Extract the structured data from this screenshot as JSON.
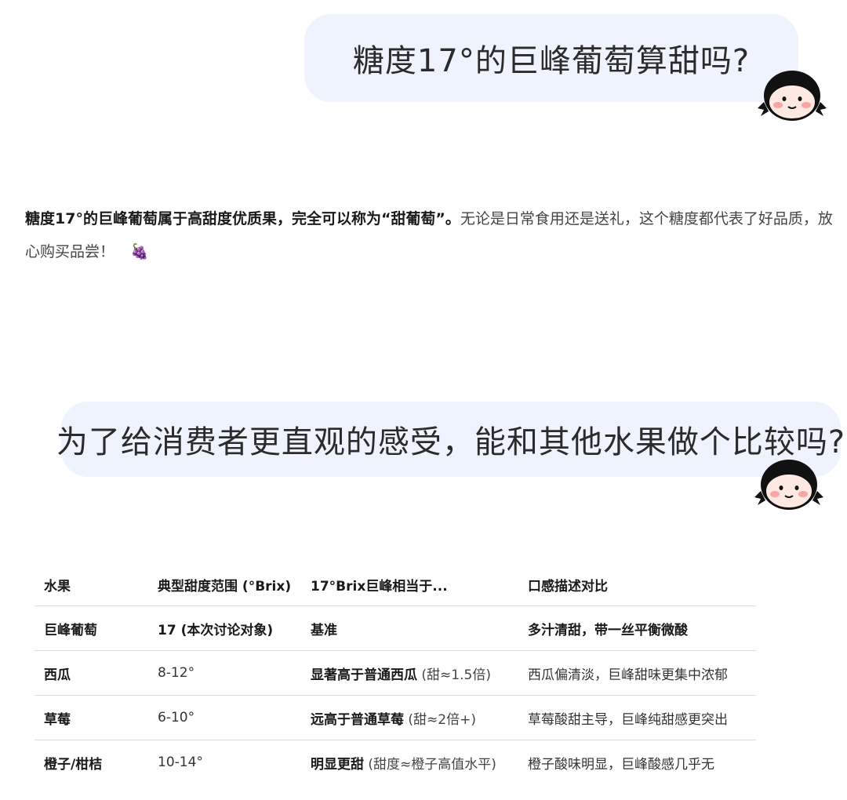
{
  "chat": {
    "question1": "糖度17°的巨峰葡萄算甜吗?",
    "answer_bold": "糖度17°的巨峰葡萄属于高甜度优质果，完全可以称为“甜葡萄”。",
    "answer_rest": "无论是日常食用还是送礼，这个糖度都代表了好品质，放心购买品尝！",
    "answer_emoji": "🍇",
    "question2": "为了给消费者更直观的感受，能和其他水果做个比较吗?"
  },
  "table": {
    "headers": [
      "水果",
      "典型甜度范围 (°Brix)",
      "17°Brix巨峰相当于...",
      "口感描述对比"
    ],
    "rows": [
      {
        "fruit": "巨峰葡萄",
        "range": "17 (本次讨论对象)",
        "equiv_bold": "基准",
        "equiv_note": "",
        "desc": "多汁清甜，带一丝平衡微酸"
      },
      {
        "fruit": "西瓜",
        "range": "8-12°",
        "equiv_bold": "显著高于普通西瓜",
        "equiv_note": " (甜≈1.5倍)",
        "desc": "西瓜偏清淡，巨峰甜味更集中浓郁"
      },
      {
        "fruit": "草莓",
        "range": "6-10°",
        "equiv_bold": "远高于普通草莓",
        "equiv_note": " (甜≈2倍+)",
        "desc": "草莓酸甜主导，巨峰纯甜感更突出"
      },
      {
        "fruit": "橙子/柑桔",
        "range": "10-14°",
        "equiv_bold": "明显更甜",
        "equiv_note": " (甜度≈橙子高值水平)",
        "desc": "橙子酸味明显，巨峰酸感几乎无"
      }
    ]
  },
  "colors": {
    "bubble_bg": "#eef3fd",
    "divider": "#dcdcdc"
  }
}
